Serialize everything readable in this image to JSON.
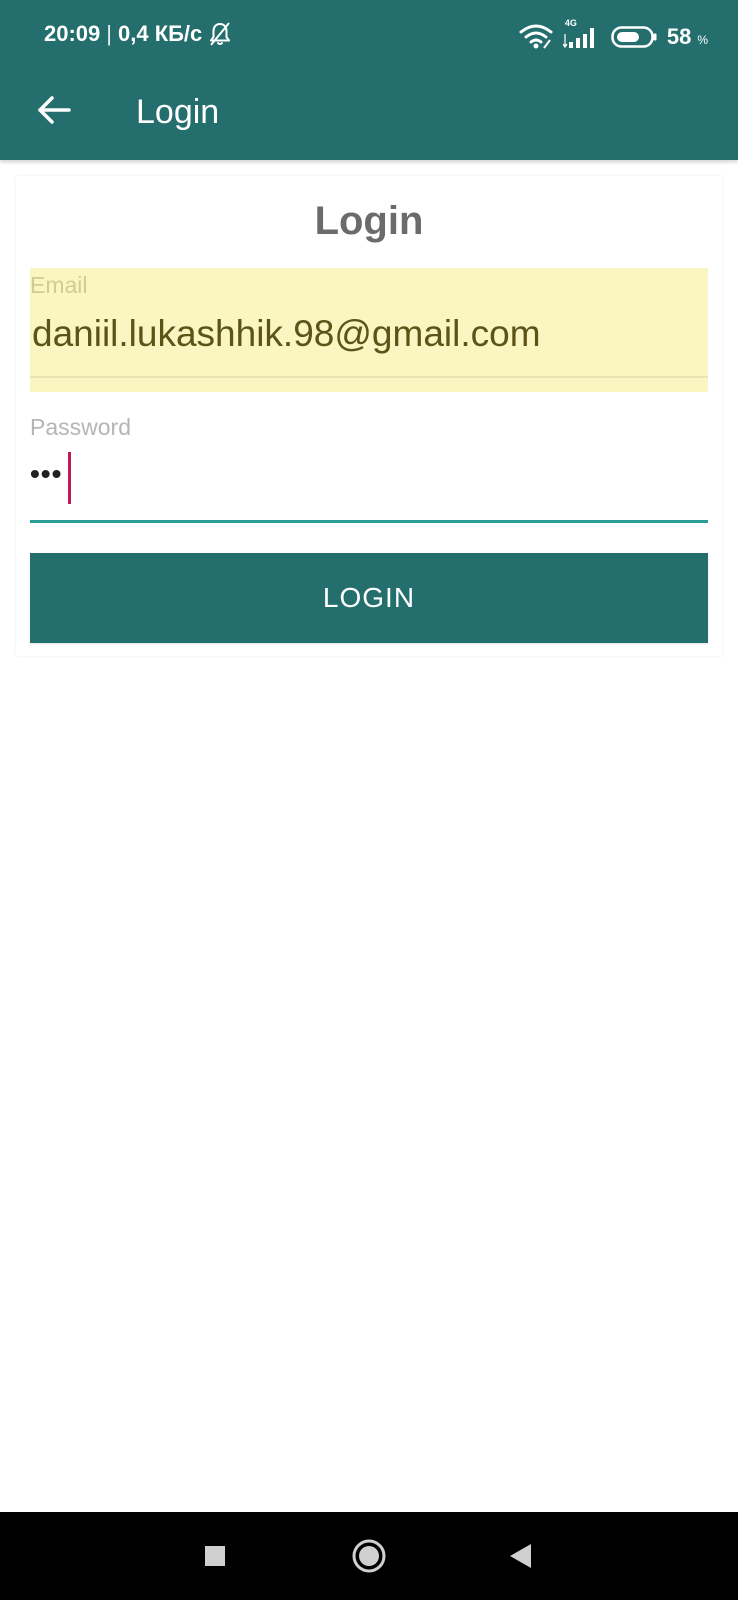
{
  "status_bar": {
    "time": "20:09",
    "separator": "|",
    "speed": "0,4 КБ/с",
    "network": "4G",
    "battery_level": "58",
    "battery_unit": "%",
    "icons": [
      "bell-off-icon",
      "wifi-icon",
      "cell-signal-icon",
      "battery-icon"
    ]
  },
  "app_bar": {
    "title": "Login",
    "back_icon": "arrow-back-icon"
  },
  "form": {
    "heading": "Login",
    "email": {
      "label": "Email",
      "value": "daniil.lukashhik.98@gmail.com"
    },
    "password": {
      "label": "Password",
      "masked_value": "•••"
    },
    "submit_label": "LOGIN"
  },
  "nav_bar": {
    "icons": [
      "recents-square-icon",
      "home-circle-icon",
      "back-triangle-icon"
    ]
  },
  "colors": {
    "primary": "#246f6e",
    "autofill_bg": "#faf6c1",
    "focus_underline": "#2a9d98",
    "cursor": "#c2185b"
  }
}
